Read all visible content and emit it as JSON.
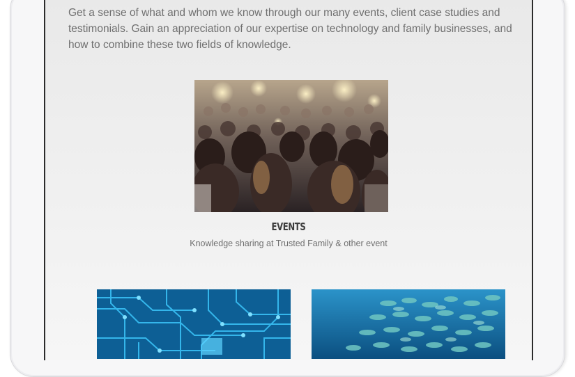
{
  "intro": {
    "text": "Get a sense of what and whom we know through our many events, client case studies and testimonials. Gain an appreciation of our expertise on technology and family businesses, and how to combine these two fields of knowledge."
  },
  "events": {
    "title": "EVENTS",
    "subtitle": "Knowledge sharing at Trusted Family & other event"
  },
  "colors": {
    "text_body": "#6f6f6f",
    "title": "#3c3c3c",
    "screen_bg": "#eeeeee",
    "circuit": "#1b9ad6",
    "ocean": "#1f7fb0"
  }
}
